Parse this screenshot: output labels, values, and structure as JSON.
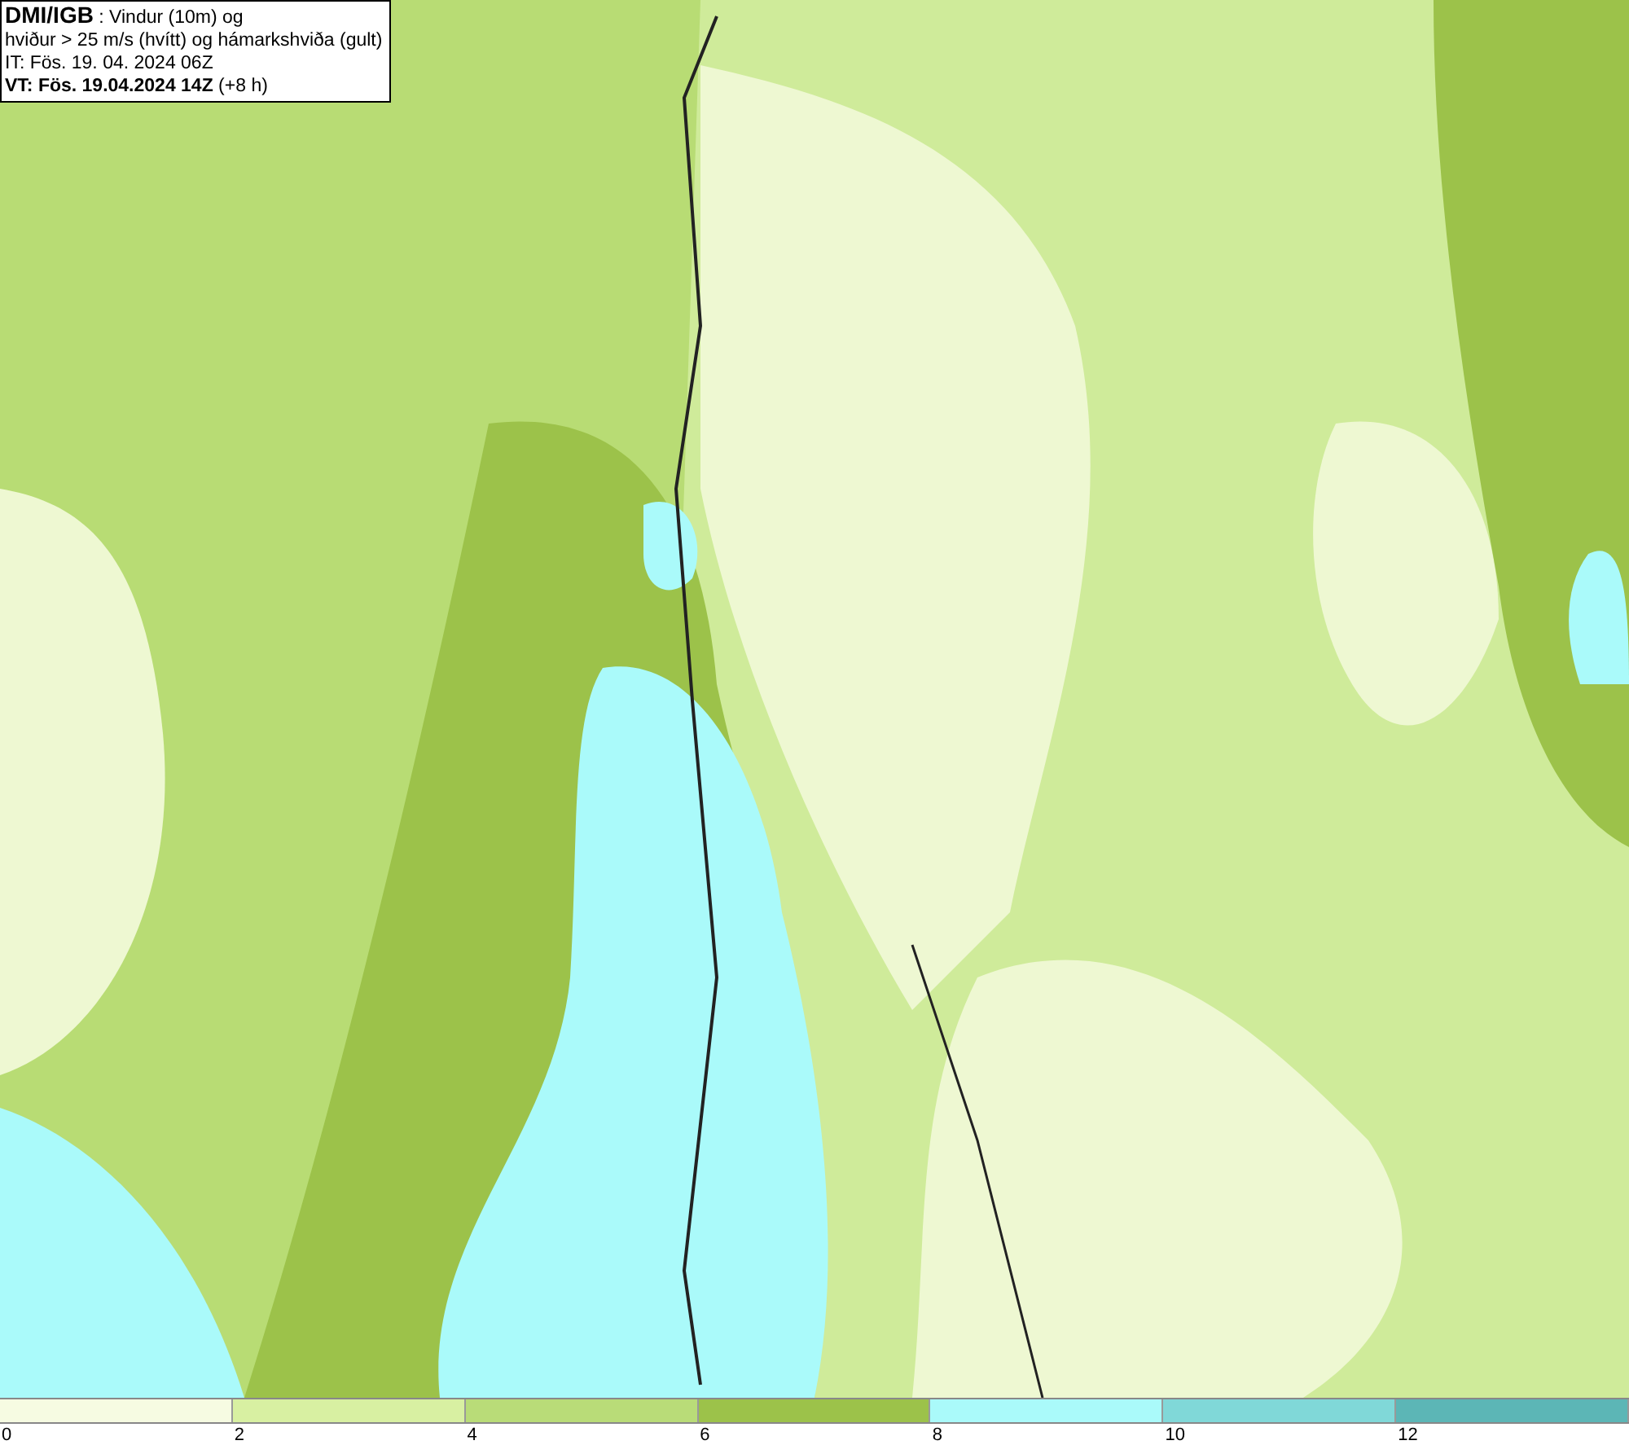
{
  "header": {
    "lines": [
      "**DMI/IGB** : Vindur (10m) og",
      "hviður > 25 m/s (hvítt) og hámarkshviða (gult)",
      "IT: Fös. 19. 04. 2024 06Z",
      "**VT: Fös. 19.04.2024 14Z** (+8 h)"
    ]
  },
  "legend": {
    "bins": [
      {
        "color": "#f6fbe2"
      },
      {
        "color": "#d8f0a2"
      },
      {
        "color": "#b9dc78"
      },
      {
        "color": "#9cc24a"
      },
      {
        "color": "#aafafa"
      },
      {
        "color": "#80d8d8"
      },
      {
        "color": "#5cb6b6"
      }
    ],
    "ticks": [
      "0",
      "2",
      "4",
      "6",
      "8",
      "10",
      "12"
    ]
  }
}
